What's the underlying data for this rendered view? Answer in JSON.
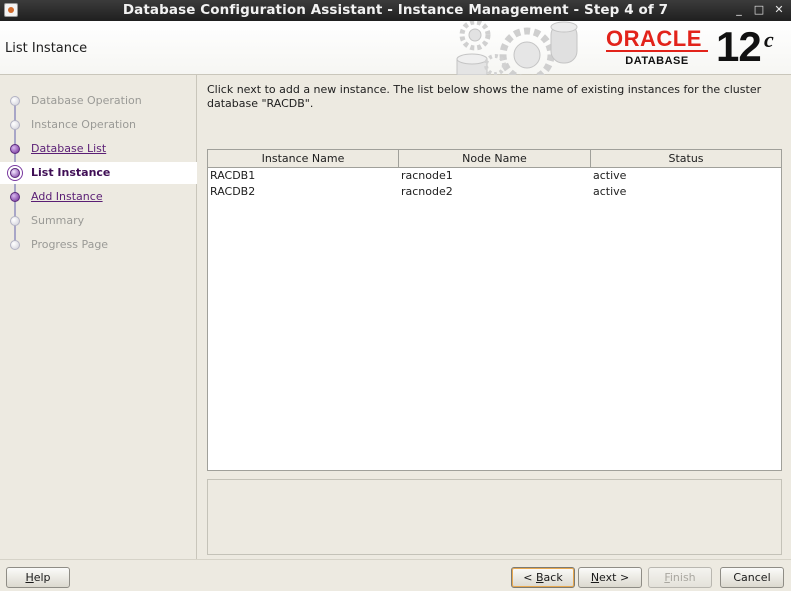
{
  "window": {
    "title": "Database Configuration Assistant - Instance Management - Step 4 of 7",
    "icon": "java-app-icon",
    "controls": [
      "_",
      "□",
      "✕"
    ]
  },
  "header": {
    "page_title": "List Instance",
    "brand": {
      "word": "ORACLE",
      "sub": "DATABASE",
      "version": "12",
      "version_sup": "c",
      "brand_color": "#e2231a"
    }
  },
  "nav": {
    "items": [
      {
        "label": "Database Operation",
        "state": "pending"
      },
      {
        "label": "Instance Operation",
        "state": "pending"
      },
      {
        "label": "Database List",
        "state": "done-link"
      },
      {
        "label": "List Instance",
        "state": "current"
      },
      {
        "label": "Add Instance",
        "state": "done-link"
      },
      {
        "label": "Summary",
        "state": "pending"
      },
      {
        "label": "Progress Page",
        "state": "pending"
      }
    ]
  },
  "main": {
    "instructions": "Click next to add a new instance. The list below shows the name of existing instances for the cluster database \"RACDB\".",
    "table": {
      "columns": [
        "Instance Name",
        "Node Name",
        "Status"
      ],
      "rows": [
        [
          "RACDB1",
          "racnode1",
          "active"
        ],
        [
          "RACDB2",
          "racnode2",
          "active"
        ]
      ]
    }
  },
  "buttons": {
    "help": {
      "pre": "",
      "mnemonic": "H",
      "post": "elp"
    },
    "back": {
      "pre": "< ",
      "mnemonic": "B",
      "post": "ack"
    },
    "next": {
      "pre": "",
      "mnemonic": "N",
      "post": "ext >"
    },
    "finish": {
      "pre": "",
      "mnemonic": "F",
      "post": "inish"
    },
    "cancel": {
      "pre": "",
      "mnemonic": "",
      "post": "Cancel"
    }
  },
  "colors": {
    "accent": "#5a1e75",
    "background": "#edeae1"
  }
}
